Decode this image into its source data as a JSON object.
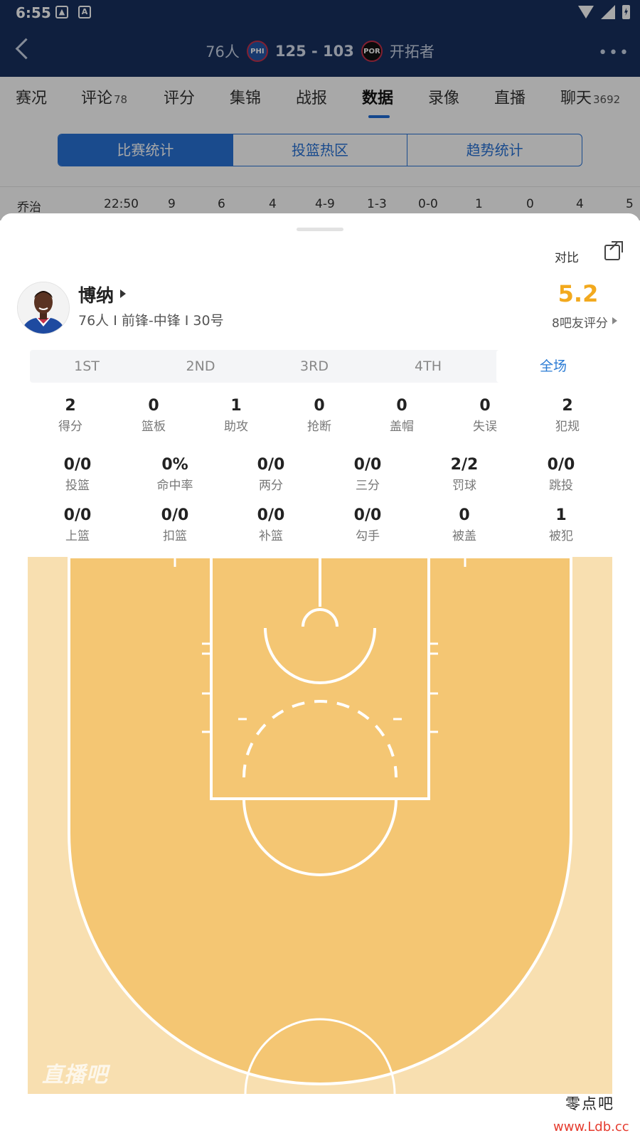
{
  "status_bar": {
    "time": "6:55",
    "notif_icons": [
      "image-icon",
      "a-icon"
    ],
    "right_icons": [
      "wifi-icon",
      "signal-icon",
      "battery-charging-icon"
    ]
  },
  "header": {
    "home_team": "76人",
    "home_logo": "PHI",
    "score": "125 - 103",
    "away_logo": "POR",
    "away_team": "开拓者"
  },
  "tabs": [
    {
      "label": "赛况",
      "badge": ""
    },
    {
      "label": "评论",
      "badge": "78"
    },
    {
      "label": "评分",
      "badge": ""
    },
    {
      "label": "集锦",
      "badge": ""
    },
    {
      "label": "战报",
      "badge": ""
    },
    {
      "label": "数据",
      "badge": "",
      "active": true
    },
    {
      "label": "录像",
      "badge": ""
    },
    {
      "label": "直播",
      "badge": ""
    },
    {
      "label": "聊天",
      "badge": "3692"
    }
  ],
  "segments": [
    "比赛统计",
    "投篮热区",
    "趋势统计"
  ],
  "peek_row": [
    "乔治",
    "22:50",
    "9",
    "6",
    "4",
    "4-9",
    "1-3",
    "0-0",
    "1",
    "0",
    "4",
    "5"
  ],
  "sheet": {
    "compare_label": "对比",
    "player": {
      "name": "博纳",
      "meta": "76人 I 前锋-中锋 I 30号"
    },
    "rating": {
      "value": "5.2",
      "sub": "8吧友评分"
    },
    "periods": [
      "1ST",
      "2ND",
      "3RD",
      "4TH",
      "全场"
    ],
    "active_period": "全场",
    "stats_row1": [
      {
        "value": "2",
        "label": "得分"
      },
      {
        "value": "0",
        "label": "篮板"
      },
      {
        "value": "1",
        "label": "助攻"
      },
      {
        "value": "0",
        "label": "抢断"
      },
      {
        "value": "0",
        "label": "盖帽"
      },
      {
        "value": "0",
        "label": "失误"
      },
      {
        "value": "2",
        "label": "犯规"
      }
    ],
    "stats_row2": [
      {
        "value": "0/0",
        "label": "投篮"
      },
      {
        "value": "0%",
        "label": "命中率"
      },
      {
        "value": "0/0",
        "label": "两分"
      },
      {
        "value": "0/0",
        "label": "三分"
      },
      {
        "value": "2/2",
        "label": "罚球"
      },
      {
        "value": "0/0",
        "label": "跳投"
      }
    ],
    "stats_row3": [
      {
        "value": "0/0",
        "label": "上篮"
      },
      {
        "value": "0/0",
        "label": "扣篮"
      },
      {
        "value": "0/0",
        "label": "补篮"
      },
      {
        "value": "0/0",
        "label": "勾手"
      },
      {
        "value": "0",
        "label": "被盖"
      },
      {
        "value": "1",
        "label": "被犯"
      }
    ],
    "court_watermark": "直播吧"
  },
  "site_watermark": {
    "line1": "零点吧",
    "line2": "www.Ldb.cc"
  },
  "colors": {
    "header_bg": "#17305f",
    "accent": "#2872d6",
    "rating": "#f2a91e",
    "court_light": "#f8dfb0",
    "court_dark": "#f4c673"
  }
}
